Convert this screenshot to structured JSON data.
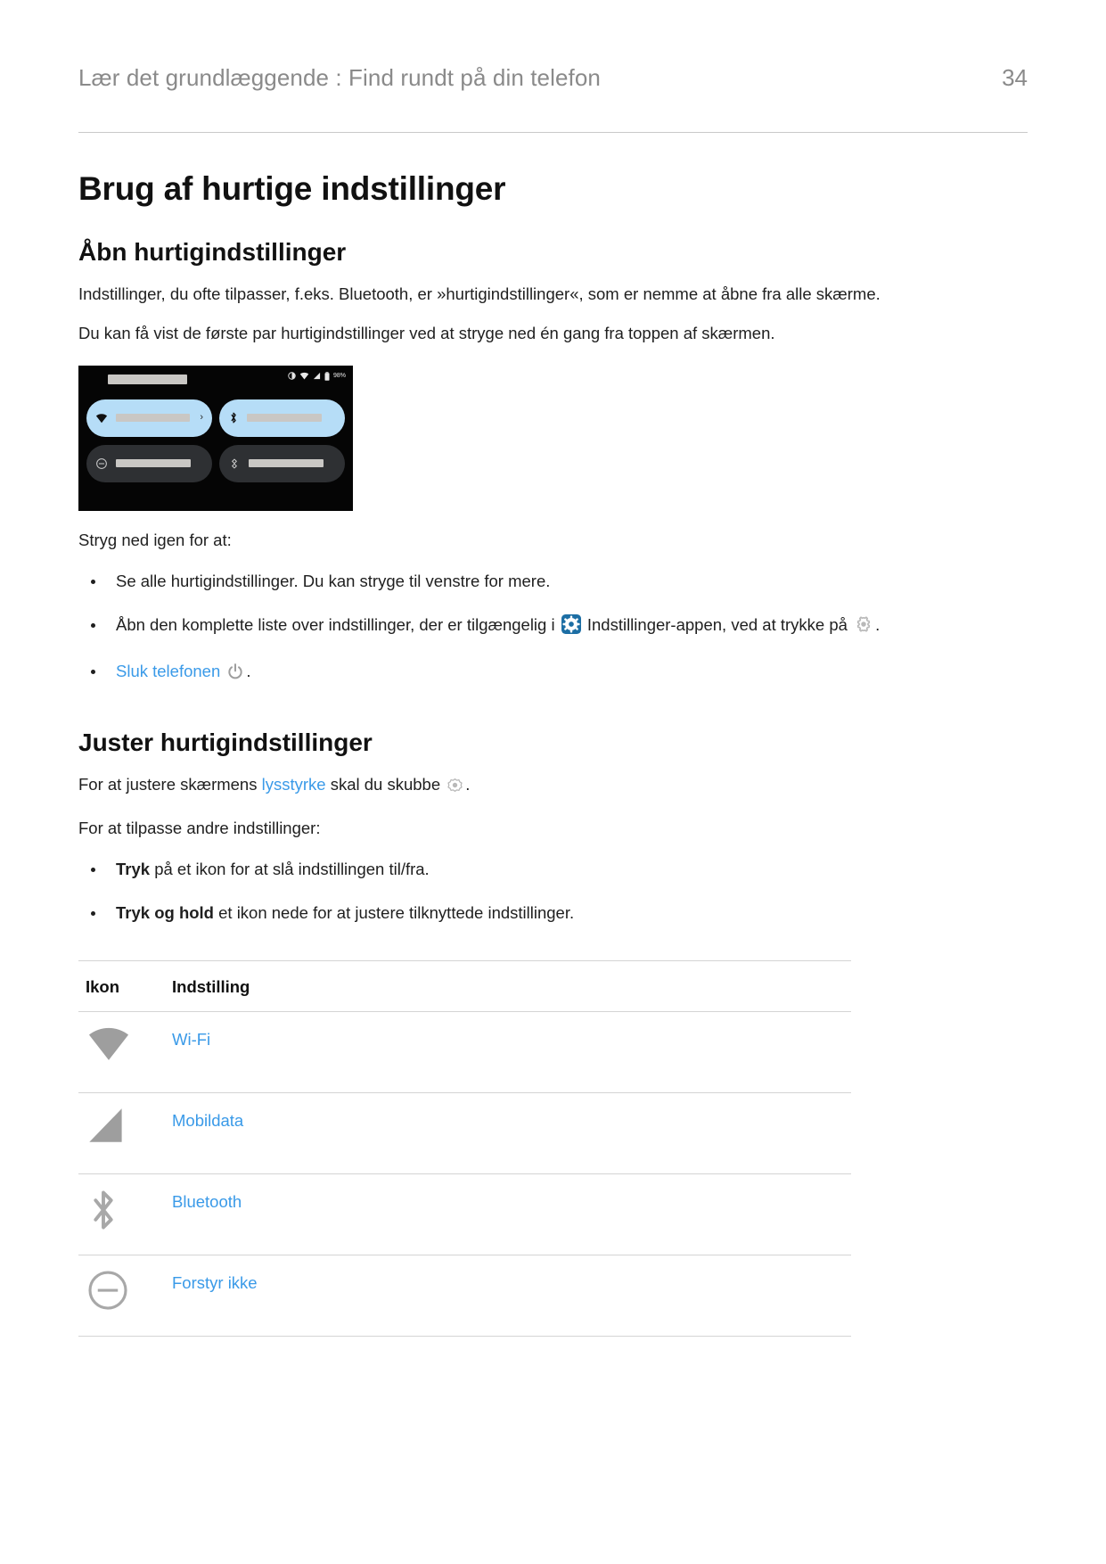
{
  "header": {
    "title": "Lær det grundlæggende : Find rundt på din telefon",
    "page_number": "34"
  },
  "doc": {
    "title": "Brug af hurtige indstillinger"
  },
  "section_open": {
    "heading": "Åbn hurtigindstillinger",
    "paragraph_1": "Indstillinger, du ofte tilpasser, f.eks. Bluetooth, er »hurtigindstillinger«, som er nemme at åbne fra alle skærme.",
    "paragraph_2": "Du kan få vist de første par hurtigindstillinger ved at stryge ned én gang fra toppen af skærmen.",
    "swipe_intro": "Stryg ned igen for at:",
    "bullets": {
      "b1": "Se alle hurtigindstillinger. Du kan stryge til venstre for mere.",
      "b2_pre": "Åbn den komplette liste over indstillinger, der er tilgængelig i",
      "b2_mid": "Indstillinger-appen, ved at trykke på",
      "b2_post": ".",
      "b3_link": "Sluk telefonen",
      "b3_post": "."
    }
  },
  "section_adjust": {
    "heading": "Juster hurtigindstillinger",
    "brightness_pre": "For at justere skærmens",
    "brightness_link": "lysstyrke",
    "brightness_mid": "skal du skubbe",
    "brightness_post": ".",
    "customize_intro": "For at tilpasse andre indstillinger:",
    "bullets": {
      "tap_bold": "Tryk",
      "tap_rest": "på et ikon for at slå indstillingen til/fra.",
      "hold_bold": "Tryk og hold",
      "hold_rest": "et ikon nede for at justere tilknyttede indstillinger."
    }
  },
  "table": {
    "headers": {
      "icon": "Ikon",
      "setting": "Indstilling"
    },
    "rows": [
      {
        "icon": "wifi-icon",
        "label": "Wi-Fi"
      },
      {
        "icon": "mobile-data-icon",
        "label": "Mobildata"
      },
      {
        "icon": "bluetooth-icon",
        "label": "Bluetooth"
      },
      {
        "icon": "do-not-disturb-icon",
        "label": "Forstyr ikke"
      }
    ]
  },
  "phone_screenshot": {
    "status_bar": {
      "battery_text": "98%",
      "icons": [
        "brightness-auto-icon",
        "wifi-icon",
        "signal-icon",
        "battery-icon"
      ]
    },
    "tiles": [
      {
        "icon": "wifi-icon",
        "state": "on",
        "has_chevron": true
      },
      {
        "icon": "bluetooth-icon",
        "state": "on",
        "has_chevron": false
      },
      {
        "icon": "do-not-disturb-icon",
        "state": "off",
        "has_chevron": false
      },
      {
        "icon": "auto-rotate-icon",
        "state": "off",
        "has_chevron": false
      }
    ]
  },
  "colors": {
    "link": "#3a9ae8",
    "header_text": "#8a8a8a",
    "tile_on": "#b6ddf7",
    "tile_off": "#2e3033",
    "gear_badge": "#1c6ea4"
  }
}
